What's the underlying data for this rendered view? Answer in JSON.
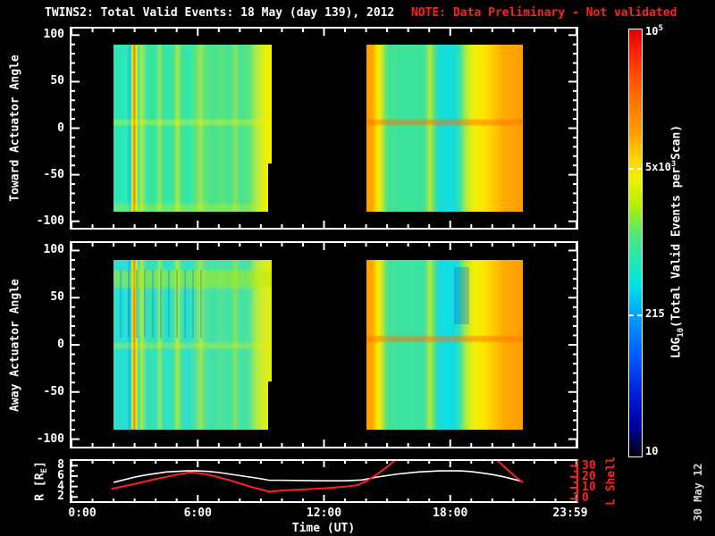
{
  "title": {
    "text": "TWINS2: Total Valid Events: 18 May (day 139), 2012",
    "note": "NOTE: Data Preliminary - Not validated"
  },
  "datestamp": "30 May 12",
  "colors": {
    "background": "#000000",
    "frame": "#ffffff",
    "note_red": "#ff2020",
    "r_line": "#ffffff",
    "l_shell_line": "#ff2020"
  },
  "axes": {
    "top_ylabel": "Toward Actuator Angle",
    "bottom_ylabel": "Away Actuator Angle",
    "strip_left_label_prefix": "R [R",
    "strip_left_label_sub": "E",
    "strip_left_label_suffix": "]",
    "strip_right_label": "L Shell",
    "xlabel": "Time (UT)"
  },
  "colorbar": {
    "title_prefix": "LOG",
    "title_sub": "10",
    "title_suffix": "(Total Valid Events per Scan)",
    "tick_top_base": "10",
    "tick_top_exp": "5",
    "tick_mid_base": "5x10",
    "tick_mid_exp": "3",
    "tick_215": "215",
    "tick_10": "10",
    "value_range": [
      10,
      100000
    ],
    "scale": "log10",
    "dashed_tick_values": [
      5000,
      215
    ],
    "gradient_stops": [
      "#dc0000 0%",
      "#ff2000 5%",
      "#ff6400 14%",
      "#ff9c00 24%",
      "#ffd200 30%",
      "#f0f000 35%",
      "#b4f000 41%",
      "#50e878 48%",
      "#22e8b2 54%",
      "#00e2e2 60%",
      "#00a8ff 66%",
      "#0064ff 75%",
      "#0026e0 84%",
      "#0000a8 92%",
      "#000048 97%",
      "#000010 100%"
    ]
  },
  "chart_data": [
    {
      "type": "heatmap",
      "panel": "toward",
      "title": "TWINS2 Total Valid Events, Toward Actuator",
      "ylabel": "Toward Actuator Angle",
      "ylim": [
        -107,
        107
      ],
      "ytick_major": [
        100,
        50,
        0,
        -50,
        -100
      ],
      "ytick_minor_step": 10,
      "x_hours_range": [
        0,
        24
      ],
      "xtick_major_every_hours": 6,
      "xtick_minor_every_hours": 1,
      "data_blocks": [
        {
          "t0": 2.0,
          "t1": 9.5,
          "angle_lo": -90,
          "angle_hi": 90,
          "css": "blk-tl",
          "description": "turquoise-green field, yellow/orange streaks near 03:00, yellow right edge, light band at angle 0"
        },
        {
          "t0": 14.0,
          "t1": 21.45,
          "angle_lo": -90,
          "angle_hi": 90,
          "css": "blk-tr",
          "description": "orange left edge, green-cyan center, yellow-orange right third, orange band at angle 0"
        }
      ]
    },
    {
      "type": "heatmap",
      "panel": "away",
      "title": "TWINS2 Total Valid Events, Away Actuator",
      "ylabel": "Away Actuator Angle",
      "ylim": [
        -108,
        108
      ],
      "ytick_major": [
        100,
        50,
        0,
        -50,
        -100
      ],
      "ytick_minor_step": 10,
      "x_hours_range": [
        0,
        24
      ],
      "xtick_major_every_hours": 6,
      "xtick_minor_every_hours": 1,
      "data_blocks": [
        {
          "t0": 2.0,
          "t1": 9.5,
          "angle_lo": -90,
          "angle_hi": 90,
          "css": "blk-bl",
          "description": "cyan field, yellow-green wavy band near +70 deg, blue vertical streaks upper left, yellow streaks near 03:00"
        },
        {
          "t0": 14.0,
          "t1": 21.45,
          "angle_lo": -90,
          "angle_hi": 90,
          "css": "blk-br",
          "description": "orange left edge, cyan center with dark blue patch, yellow-orange right third, orange band at angle 0"
        }
      ]
    },
    {
      "type": "line",
      "panel": "orbit",
      "xlabel": "Time (UT)",
      "xticks_hours": [
        0,
        6,
        12,
        18,
        24
      ],
      "xtick_labels": [
        "0:00",
        "6:00",
        "12:00",
        "18:00",
        "23:59"
      ],
      "left_axis": {
        "label": "R [RE]",
        "ylim": [
          1.2,
          8.9
        ],
        "ticks": [
          2,
          4,
          6,
          8
        ],
        "minor": [
          3,
          5,
          7
        ],
        "color": "#ffffff"
      },
      "right_axis": {
        "label": "L Shell",
        "ylim": [
          -2.2,
          34.5
        ],
        "ticks": [
          0,
          10,
          20,
          30
        ],
        "minor": [
          5,
          15,
          25
        ],
        "color": "#ff2020"
      },
      "series": [
        {
          "name": "R",
          "axis": "left",
          "color": "#ffffff",
          "width": 1.6,
          "segments": [
            [
              [
                2.0,
                4.8
              ],
              [
                2.5,
                5.3
              ],
              [
                3,
                5.8
              ],
              [
                3.5,
                6.2
              ],
              [
                4,
                6.5
              ],
              [
                4.5,
                6.8
              ],
              [
                5,
                6.9
              ],
              [
                5.5,
                7.0
              ],
              [
                6,
                7.0
              ],
              [
                6.5,
                6.9
              ],
              [
                7,
                6.7
              ],
              [
                7.5,
                6.4
              ],
              [
                8,
                6.1
              ],
              [
                8.5,
                5.8
              ],
              [
                9,
                5.5
              ],
              [
                9.4,
                5.2
              ],
              [
                10,
                5.2
              ],
              [
                11,
                5.15
              ],
              [
                12,
                5.1
              ],
              [
                13,
                5.1
              ],
              [
                13.8,
                5.25
              ],
              [
                14.5,
                5.8
              ],
              [
                15,
                6.1
              ],
              [
                15.5,
                6.4
              ],
              [
                16,
                6.6
              ],
              [
                16.5,
                6.8
              ],
              [
                17,
                6.9
              ],
              [
                17.5,
                7.0
              ],
              [
                18,
                7.0
              ],
              [
                18.5,
                7.0
              ],
              [
                19,
                6.85
              ],
              [
                19.5,
                6.6
              ],
              [
                20,
                6.3
              ],
              [
                20.5,
                5.9
              ],
              [
                21,
                5.4
              ],
              [
                21.4,
                5.0
              ]
            ]
          ]
        },
        {
          "name": "L Shell",
          "axis": "right",
          "color": "#ff2020",
          "width": 2,
          "segments": [
            [
              [
                1.9,
                9
              ],
              [
                3,
                13.5
              ],
              [
                4,
                18
              ],
              [
                5,
                22
              ],
              [
                5.6,
                24
              ],
              [
                6,
                23.5
              ],
              [
                6.5,
                22
              ],
              [
                7,
                19.5
              ],
              [
                7.5,
                17
              ],
              [
                8,
                14
              ],
              [
                8.5,
                11
              ],
              [
                9,
                8.5
              ],
              [
                9.4,
                6.5
              ],
              [
                10,
                7.5
              ],
              [
                11,
                8.5
              ],
              [
                12,
                9.5
              ],
              [
                13,
                11
              ],
              [
                13.6,
                12.5
              ],
              [
                14,
                16
              ],
              [
                14.5,
                22
              ],
              [
                15,
                29
              ],
              [
                15.45,
                36.5
              ]
            ],
            [
              [
                20.15,
                36.5
              ],
              [
                20.7,
                27
              ],
              [
                21.1,
                20
              ],
              [
                21.45,
                15
              ]
            ]
          ]
        }
      ]
    }
  ]
}
